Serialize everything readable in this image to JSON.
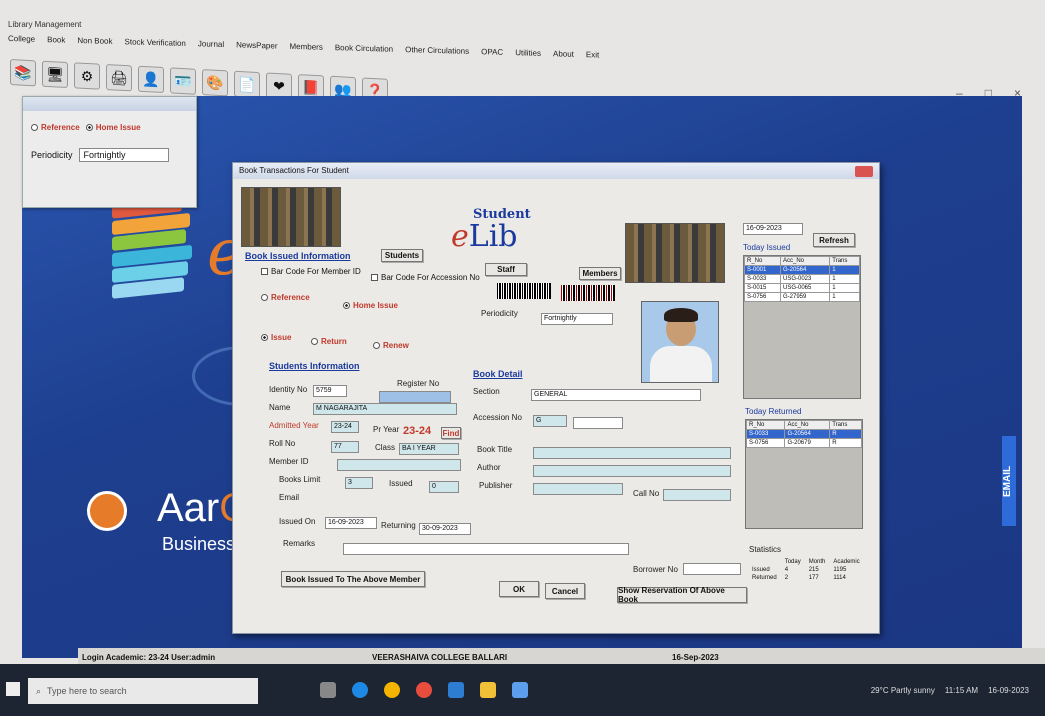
{
  "app": {
    "title": "Library Management"
  },
  "menu": [
    "College",
    "Book",
    "Non Book",
    "Stock Verification",
    "Journal",
    "NewsPaper",
    "Members",
    "Book Circulation",
    "Other Circulations",
    "OPAC",
    "Utilities",
    "About",
    "Exit"
  ],
  "window_controls": {
    "minimize": "–",
    "maximize": "□",
    "close": "×"
  },
  "small_window": {
    "reference": "Reference",
    "home_issue": "Home Issue",
    "periodicity_label": "Periodicity",
    "periodicity_value": "Fortnightly"
  },
  "desktop": {
    "brand_main": "Aar",
    "brand_accent": "Ge",
    "brand_sub": "Business Sol",
    "side_tab": "EMAIL"
  },
  "dialog": {
    "title": "Book Transactions For Student",
    "logo_top": "Student",
    "logo_e": "e",
    "logo_lib": "Lib",
    "section_book_issued": "Book Issued Information",
    "btn_students": "Students",
    "btn_staff": "Staff",
    "btn_members": "Members",
    "chk_member": "Bar Code For Member ID",
    "chk_accession": "Bar Code For Accession No",
    "radio_reference": "Reference",
    "radio_home": "Home Issue",
    "periodicity_label": "Periodicity",
    "periodicity_value": "Fortnightly",
    "radio_issue": "Issue",
    "radio_return": "Return",
    "radio_renew": "Renew",
    "students_info": "Students Information",
    "identity_label": "Identity No",
    "identity_value": "5759",
    "register_label": "Register No",
    "name_label": "Name",
    "name_value": "M NAGARAJITA",
    "admitted_label": "Admitted Year",
    "admitted_value": "23-24",
    "pr_year_label": "Pr Year",
    "pr_year_value": "23-24",
    "btn_find": "Find",
    "roll_label": "Roll No",
    "roll_value": "77",
    "class_label": "Class",
    "class_value": "BA I YEAR",
    "member_label": "Member ID",
    "books_limit_label": "Books Limit",
    "books_limit_value": "3",
    "issued_label": "Issued",
    "issued_value": "0",
    "email_label": "Email",
    "book_detail": "Book Detail",
    "section_label": "Section",
    "section_value": "GENERAL",
    "accession_label": "Accession No",
    "accession_value": "G",
    "book_title_label": "Book Title",
    "author_label": "Author",
    "publisher_label": "Publisher",
    "call_label": "Call No",
    "issued_on_label": "Issued On",
    "issued_on_value": "16-09-2023",
    "returning_label": "Returning",
    "returning_value": "30-09-2023",
    "remarks_label": "Remarks",
    "borrower_label": "Borrower No",
    "btn_book_issued": "Book Issued To The Above Member",
    "btn_ok": "OK",
    "btn_cancel": "Cancel",
    "btn_show_reservation": "Show Reservation Of Above Book",
    "date_picker": "16-09-2023",
    "btn_refresh": "Refresh",
    "today_issued": "Today Issued",
    "today_returned": "Today Returned",
    "grid_headers": [
      "R_No",
      "Acc_No",
      "Trans"
    ],
    "issued_rows": [
      [
        "S-0001",
        "G-20564",
        "1"
      ],
      [
        "S-0033",
        "USG-0023",
        "1"
      ],
      [
        "S-0015",
        "USG-0065",
        "1"
      ],
      [
        "S-0756",
        "G-27959",
        "1"
      ]
    ],
    "returned_rows": [
      [
        "S-0033",
        "G-20564",
        "R"
      ],
      [
        "S-0756",
        "G-20679",
        "R"
      ]
    ],
    "statistics": "Statistics",
    "stat_headers": [
      "Today",
      "Month",
      "Academic"
    ],
    "stat_rows": [
      [
        "Issued",
        "4",
        "215",
        "1195"
      ],
      [
        "Returned",
        "2",
        "177",
        "1114"
      ]
    ]
  },
  "status": {
    "login": "Login Academic: 23-24  User:admin",
    "college": "VEERASHAIVA COLLEGE BALLARI",
    "date": "16-Sep-2023"
  },
  "taskbar": {
    "search_placeholder": "Type here to search",
    "weather": "29°C  Partly sunny",
    "time": "11:15 AM",
    "date": "16-09-2023"
  }
}
